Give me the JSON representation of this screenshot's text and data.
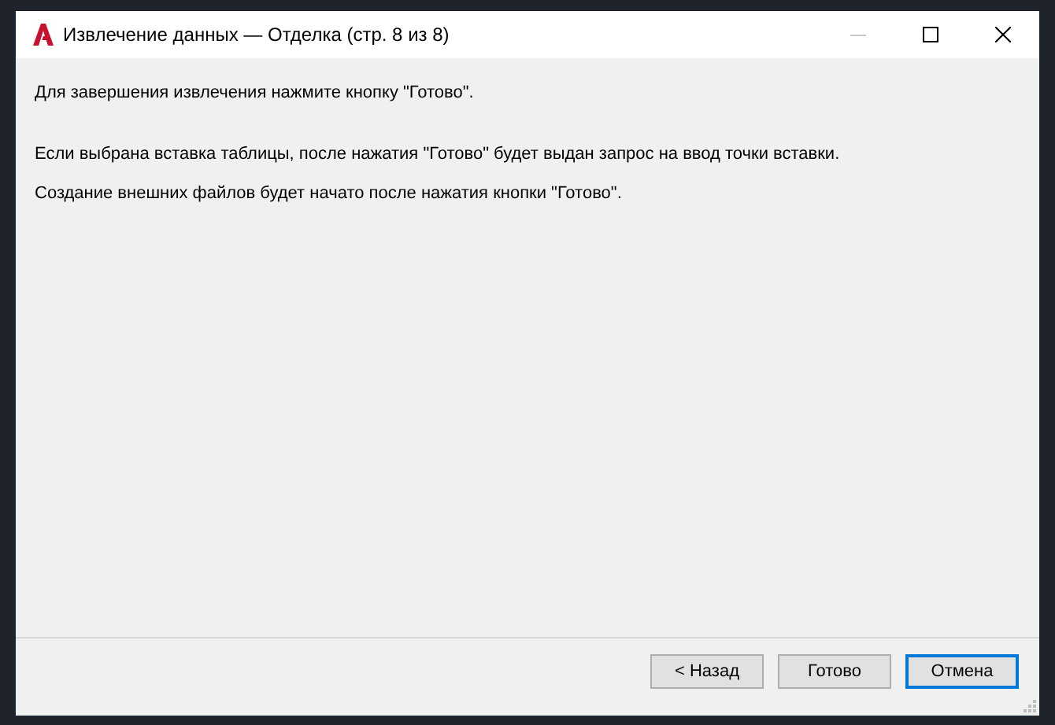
{
  "window": {
    "title": "Извлечение данных — Отделка (стр. 8 из 8)",
    "minimize_disabled": true
  },
  "messages": [
    "Для завершения извлечения нажмите кнопку \"Готово\".",
    "Если выбрана вставка таблицы, после нажатия \"Готово\" будет выдан запрос на ввод точки вставки.",
    "Создание внешних файлов будет начато после нажатия кнопки \"Готово\"."
  ],
  "buttons": [
    {
      "label": "< Назад",
      "focused": false
    },
    {
      "label": "Готово",
      "focused": false
    },
    {
      "label": "Отмена",
      "focused": true
    }
  ]
}
